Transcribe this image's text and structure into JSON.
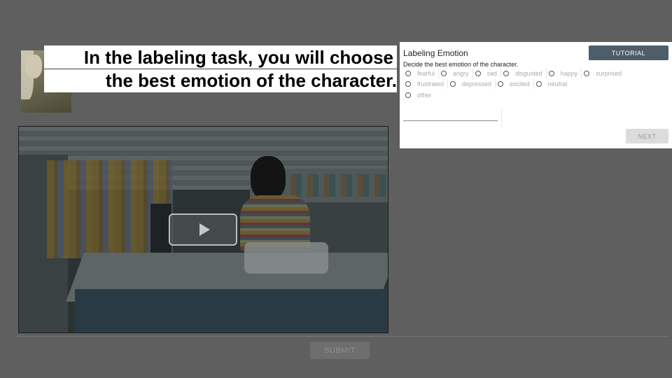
{
  "caption": {
    "line1": "In the labeling task, you will choose",
    "line2": "the best emotion of the character."
  },
  "panel": {
    "title": "Labeling Emotion",
    "subtitle": "Decide the best emotion of the character.",
    "tutorial_label": "TUTORIAL",
    "next_label": "NEXT",
    "rows": [
      [
        "fearful",
        "angry",
        "sad",
        "disgusted",
        "happy",
        "surprised"
      ],
      [
        "frustrated",
        "depressed",
        "excited",
        "neutral"
      ],
      [
        "other"
      ]
    ]
  },
  "video": {
    "play_icon": "play-icon"
  },
  "footer": {
    "submit_label": "SUBMIT"
  }
}
